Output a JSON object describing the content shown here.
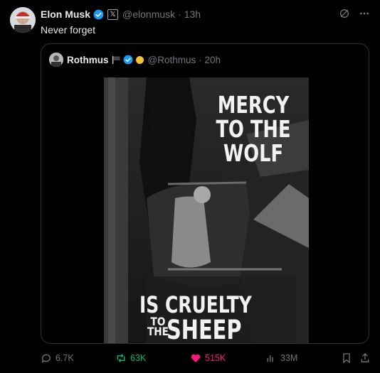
{
  "author": {
    "name": "Elon Musk",
    "handle": "@elonmusk",
    "time": "· 13h",
    "affiliate_badge": "𝕏"
  },
  "tweet_text": "Never forget",
  "quoted": {
    "name": "Rothmus",
    "handle": "@Rothmus",
    "time": "· 20h",
    "image_text": {
      "line1": "MERCY",
      "line2": "TO THE",
      "line3": "WOLF",
      "line4": "IS CRUELTY",
      "to": "TO",
      "the": "THE",
      "sheep": "SHEEP"
    }
  },
  "actions": {
    "replies": "6.7K",
    "reposts": "63K",
    "likes": "515K",
    "views": "33M"
  },
  "colors": {
    "verified": "#1d9bf0",
    "repost": "#00ba7c",
    "like": "#f91880",
    "muted": "#71767b"
  }
}
